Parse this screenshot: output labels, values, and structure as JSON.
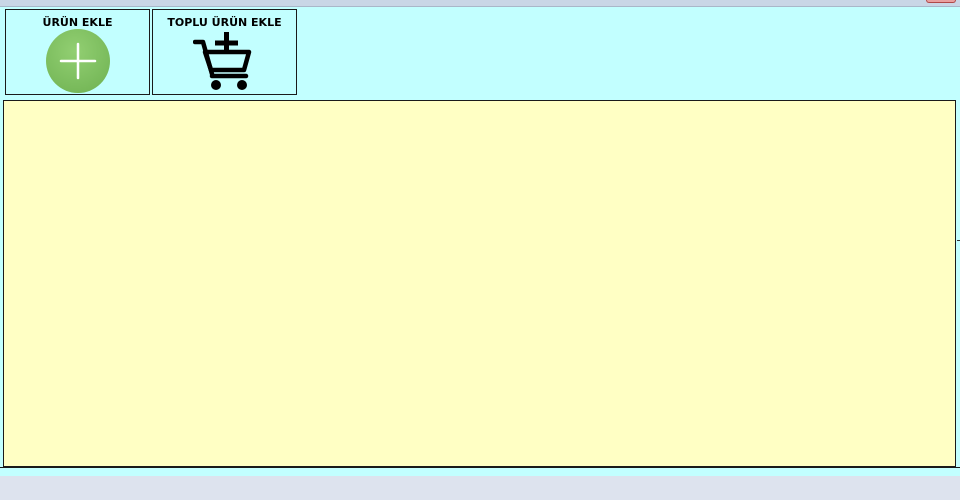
{
  "toolbar": {
    "add_product_label": "ÜRÜN EKLE",
    "add_product_icon": "plus-circle-icon",
    "bulk_add_label": "TOPLU ÜRÜN EKLE",
    "bulk_add_icon": "cart-plus-icon"
  },
  "colors": {
    "toolbar_bg": "#c2ffff",
    "content_bg": "#ffffc4",
    "plus_circle": "#7cbd5e",
    "page_bg": "#dde3ee"
  }
}
